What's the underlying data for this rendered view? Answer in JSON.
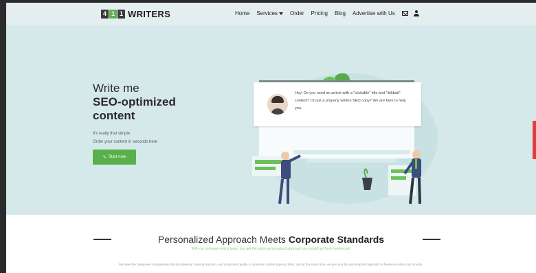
{
  "header": {
    "logo_chars": [
      "4",
      "1",
      "1"
    ],
    "logo_text": "WRITERS",
    "nav": [
      "Home",
      "Services",
      "Order",
      "Pricing",
      "Blog",
      "Advertise with Us"
    ]
  },
  "hero": {
    "title_line1": "Write me",
    "title_line2": "SEO-optimized",
    "title_line3": "content",
    "sub_line1": "It's really that simple",
    "sub_line2": "Order your content in seconds here",
    "cta": "Start now",
    "chat": "Hey! Do you need an article with a \"clickable\" title and \"linkbait\" content? Or just a properly written SEO copy? We are here to help you."
  },
  "section": {
    "title_light": "Personalized Approach Meets ",
    "title_bold": "Corporate Standards",
    "subtitle": "With our in-house writing team, you get the same personalized approach you would get from freelancers!",
    "body": "We have the manpower to guarantee the fast delivery, mass production, and consistent quality a corporate content agency offers, and at the same time, we give you the personalized approach a freelance writer can provide."
  },
  "colors": {
    "accent": "#58b04a",
    "hero_bg": "#d6e9ea",
    "header_bg": "#e4eeee"
  },
  "icons": [
    "mail-icon",
    "user-icon",
    "pencil-icon"
  ]
}
